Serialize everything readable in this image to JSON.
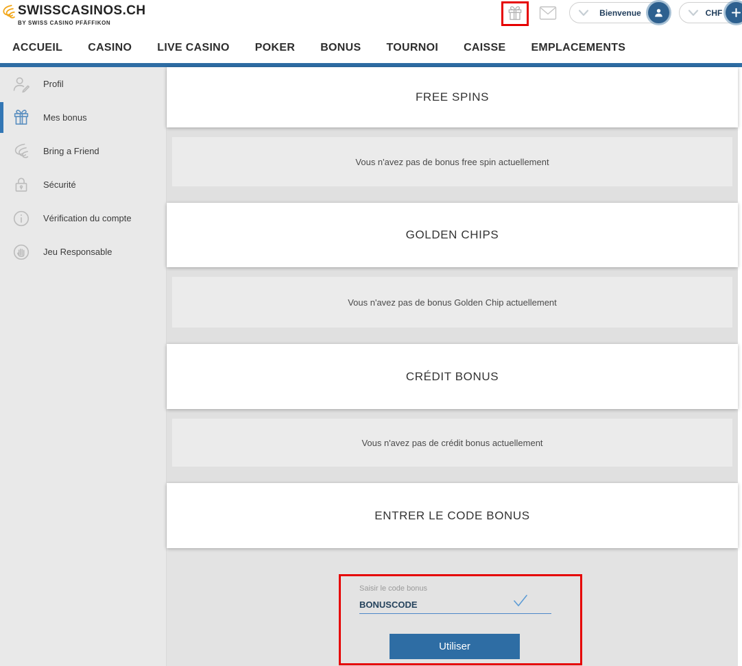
{
  "header": {
    "logo": {
      "title": "SWISSCASINOS.CH",
      "subtitle": "BY SWISS CASINO PFÄFFIKON"
    },
    "welcome": {
      "label": "Bienvenue"
    },
    "currency": {
      "label": "CHF"
    }
  },
  "nav": {
    "items": [
      "ACCUEIL",
      "CASINO",
      "LIVE CASINO",
      "POKER",
      "BONUS",
      "TOURNOI",
      "CAISSE",
      "EMPLACEMENTS"
    ]
  },
  "sidebar": {
    "items": [
      {
        "label": "Profil"
      },
      {
        "label": "Mes bonus",
        "active": true
      },
      {
        "label": "Bring a Friend"
      },
      {
        "label": "Sécurité"
      },
      {
        "label": "Vérification du compte"
      },
      {
        "label": "Jeu Responsable"
      }
    ]
  },
  "sections": [
    {
      "title": "FREE SPINS",
      "message": "Vous n'avez pas de bonus free spin actuellement"
    },
    {
      "title": "GOLDEN CHIPS",
      "message": "Vous n'avez pas de bonus Golden Chip actuellement"
    },
    {
      "title": "CRÉDIT BONUS",
      "message": "Vous n'avez pas de crédit bonus actuellement"
    }
  ],
  "bonus_code": {
    "title": "ENTRER LE CODE BONUS",
    "input_label": "Saisir le code bonus",
    "input_value": "BONUSCODE",
    "button_label": "Utiliser"
  },
  "colors": {
    "accent_blue": "#2e6da4",
    "active_item_blue": "#3377b5",
    "underline_blue": "#4a86c8",
    "highlight_red": "#e60000",
    "logo_gold": "#f2a71b"
  }
}
